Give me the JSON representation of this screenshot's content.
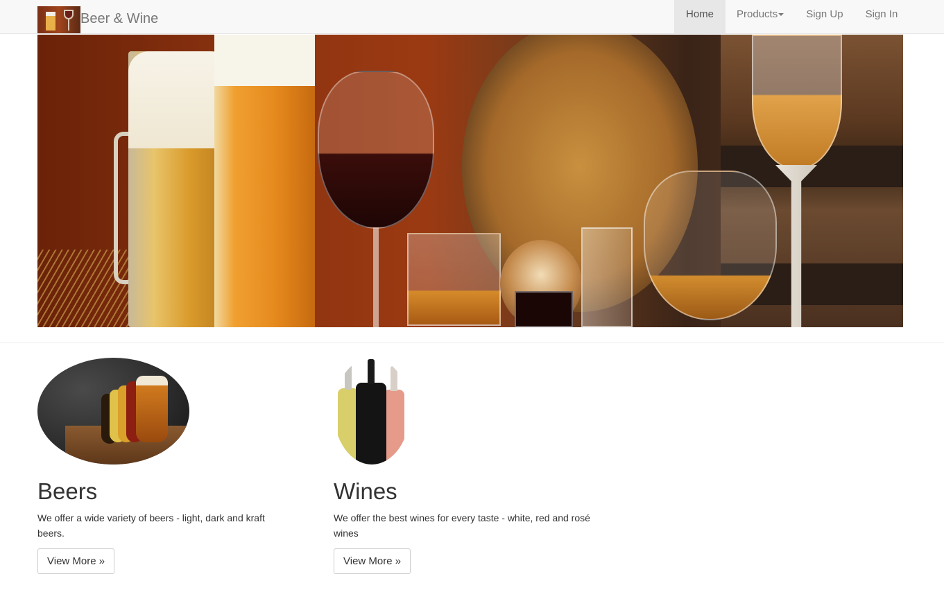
{
  "navbar": {
    "brand_text": "Beer & Wine",
    "brand_logo_icon": "beer-and-wine-glasses-logo",
    "items": [
      {
        "label": "Home",
        "active": true
      },
      {
        "label": "Products",
        "has_dropdown": true
      },
      {
        "label": "Sign Up"
      },
      {
        "label": "Sign In"
      }
    ]
  },
  "hero": {
    "image": "beer-mugs-wine-glasses-barrels-photo"
  },
  "features": [
    {
      "title": "Beers",
      "image": "beer-tasting-glasses-photo",
      "description": "We offer a wide variety of beers - light, dark and kraft beers.",
      "button_label": "View More »"
    },
    {
      "title": "Wines",
      "image": "wine-bottles-photo",
      "description": "We offer the best wines for every taste - white, red and rosé wines",
      "button_label": "View More »"
    }
  ],
  "colors": {
    "navbar_bg": "#f8f8f8",
    "active_nav_bg": "#e7e7e7",
    "nav_text": "#777777",
    "body_text": "#333333"
  }
}
